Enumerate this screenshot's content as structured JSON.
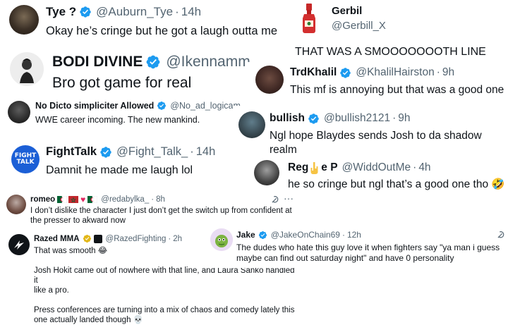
{
  "tweets": {
    "tye": {
      "name": "Tye ?",
      "handle": "@Auburn_Tye",
      "time": "14h",
      "text": "Okay he’s cringe but he got a laugh outta me"
    },
    "gerbil": {
      "name": "Gerbil",
      "handle": "@Gerbill_X",
      "text": "THAT WAS A SMOOOOOOOTH LINE"
    },
    "bodi": {
      "name": "BODI DIVINE",
      "handle": "@Ikennamm",
      "text": "Bro got game for real"
    },
    "trdkhalil": {
      "name": "TrdKhalil",
      "handle": "@KhalilHairston",
      "time": "9h",
      "text": "This mf is annoying but that was a good one"
    },
    "nodicto": {
      "name": "No Dicto simpliciter Allowed",
      "handle": "@No_ad_logicam",
      "text": "WWE career incoming. The new mankind."
    },
    "bullish": {
      "name": "bullish",
      "handle": "@bullish2121",
      "time": "9h",
      "text": "Ngl hope Blaydes sends Josh to da shadow realm"
    },
    "fighttalk": {
      "name": "FightTalk",
      "handle": "@Fight_Talk_",
      "time": "14h",
      "text": "Damnit he made me laugh lol",
      "avatar_line1": "FIGHT",
      "avatar_line2": "TALK"
    },
    "reg": {
      "name_a": "Reg",
      "name_b": "e P",
      "handle": "@WiddOutMe",
      "time": "4h",
      "text": "he so cringe but ngl that’s a good one tho",
      "emoji": "🤣"
    },
    "romeo": {
      "name": "romeo",
      "handle": "@redabylka_",
      "time": "8h",
      "text_line1": "I don’t dislike the character I just don’t get the switch up from confident at",
      "text_line2": "the presser to akward now",
      "more": "···"
    },
    "razed": {
      "name": "Razed MMA",
      "handle": "@RazedFighting",
      "time": "2h",
      "p1": "That was smooth",
      "p1_emoji": "😂",
      "p2_line1": "Josh Hokit came out of nowhere with that line, and Laura Sanko handled it",
      "p2_line2": "like a pro.",
      "p3_line1": "Press conferences are turning into a mix of chaos and comedy lately this",
      "p3_line2": "one actually landed though",
      "p3_emoji": "💀"
    },
    "jake": {
      "name": "Jake",
      "handle": "@JakeOnChain69",
      "time": "12h",
      "text_line1": "The dudes who hate this guy love it when fighters say \"ya man i guess",
      "text_line2": "maybe can find out saturday night\" and have 0 personality"
    }
  },
  "colors": {
    "verified_blue": "#1d9bf0",
    "verified_gold": "#e2b719",
    "grok_gray": "#536471"
  },
  "icons": {
    "verified": "verified-badge-icon",
    "grok": "grok-icon",
    "more": "more-icon",
    "hot_sauce": "hot-sauce-bottle-icon",
    "hand": "hand-emoji-icon"
  }
}
